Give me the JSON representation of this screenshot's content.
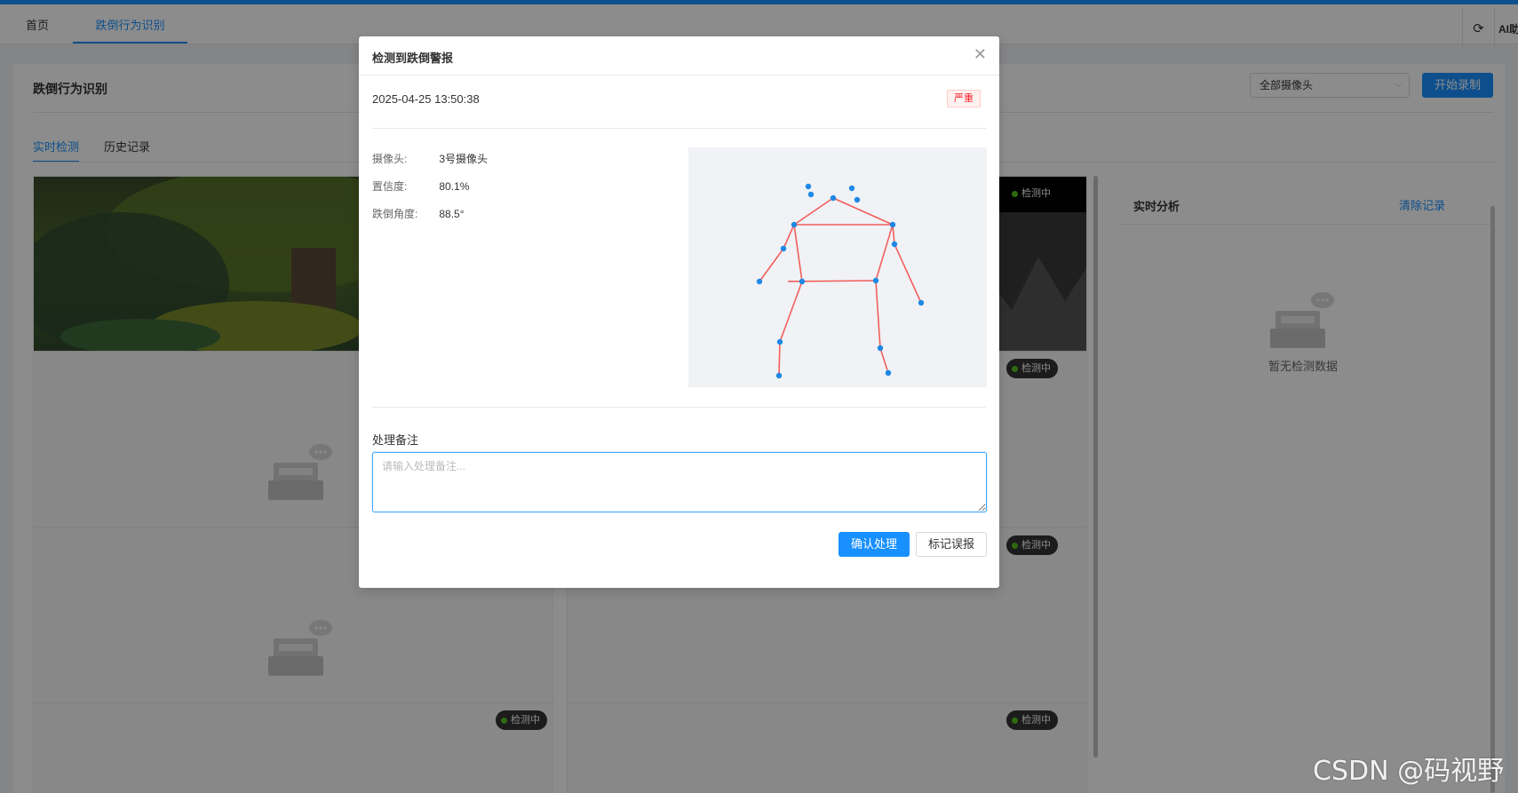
{
  "nav": {
    "tabs": [
      {
        "label": "首页",
        "active": false
      },
      {
        "label": "跌倒行为识别",
        "active": true
      }
    ],
    "ai_label": "AI助",
    "refresh_icon": "refresh-icon",
    "accent_color": "#1890ff"
  },
  "page": {
    "title": "跌倒行为识别",
    "camera_select": "全部摄像头",
    "record_button": "开始录制",
    "sub_tabs": [
      {
        "label": "实时检测",
        "active": true
      },
      {
        "label": "历史记录",
        "active": false
      }
    ]
  },
  "videos": {
    "status_label": "检测中"
  },
  "panel": {
    "title": "实时分析",
    "clear_label": "清除记录",
    "empty_text": "暂无检测数据"
  },
  "modal": {
    "title": "检测到跌倒警报",
    "timestamp": "2025-04-25 13:50:38",
    "severity": "严重",
    "severity_color": "#f5222d",
    "camera_label": "摄像头:",
    "camera_value": "3号摄像头",
    "confidence_label": "置信度:",
    "confidence_value": "80.1%",
    "angle_label": "跌倒角度:",
    "angle_value": "88.5°",
    "remark_label": "处理备注",
    "remark_placeholder": "请输入处理备注...",
    "remark_value": "",
    "confirm_button": "确认处理",
    "false_alarm_button": "标记误报"
  },
  "watermark": "CSDN @码视野"
}
